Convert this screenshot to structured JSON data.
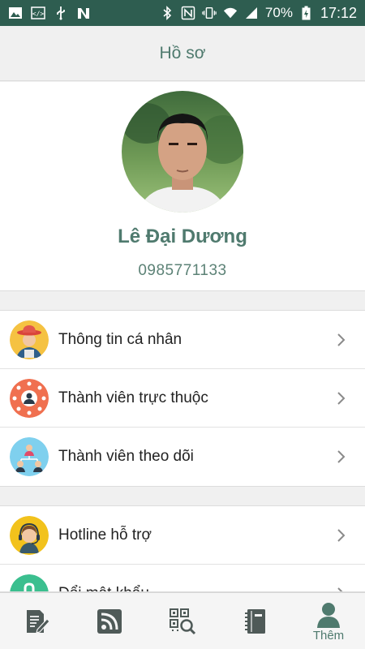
{
  "status_bar": {
    "battery": "70%",
    "time": "17:12"
  },
  "header": {
    "title": "Hồ sơ"
  },
  "profile": {
    "name": "Lê Đại Dương",
    "phone": "0985771133"
  },
  "menu": {
    "group1": [
      {
        "label": "Thông tin cá nhân",
        "icon": "farmer-avatar-icon"
      },
      {
        "label": "Thành viên trực thuộc",
        "icon": "member-network-icon"
      },
      {
        "label": "Thành viên theo dõi",
        "icon": "team-hierarchy-icon"
      }
    ],
    "group2": [
      {
        "label": "Hotline hỗ trợ",
        "icon": "support-headset-icon"
      },
      {
        "label": "Đổi mật khẩu",
        "icon": "lock-icon"
      }
    ]
  },
  "bottom_nav": {
    "tabs": [
      {
        "name": "document-edit-icon",
        "label": ""
      },
      {
        "name": "rss-feed-icon",
        "label": ""
      },
      {
        "name": "qr-scan-icon",
        "label": ""
      },
      {
        "name": "notebook-icon",
        "label": ""
      },
      {
        "name": "user-profile-icon",
        "label": "Thêm"
      }
    ]
  },
  "colors": {
    "status_bar": "#2e5d50",
    "accent": "#4f7a6e",
    "background": "#f0f0f0"
  }
}
